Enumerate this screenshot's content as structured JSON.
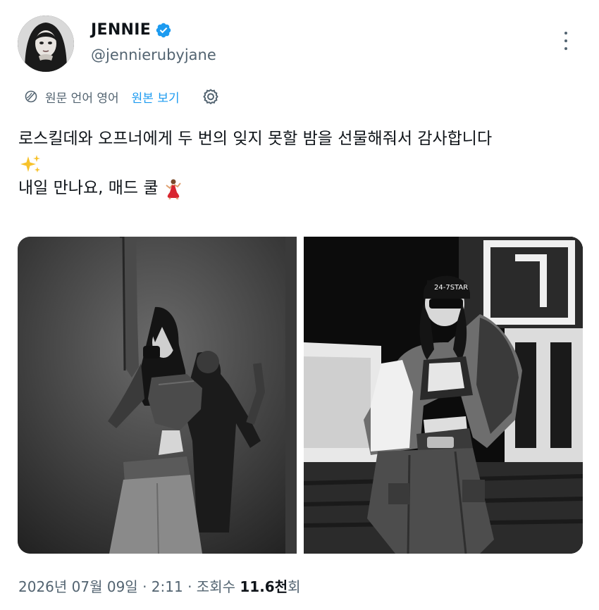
{
  "tweet": {
    "display_name": "JENNIE",
    "handle": "@jennierubyjane",
    "verified_icon": "verified-badge-icon",
    "more_icon": "more-horizontal-icon",
    "translate": {
      "label": "원문 언어 영어",
      "view_original": "원본 보기",
      "globe_icon": "globe-translate-icon",
      "settings_icon": "gear-icon"
    },
    "text_line_1": "로스킬데와 오프너에게 두 번의 잊지 못할 밤을 선물해줘서 감사합니다",
    "text_line_2_emoji": "sparkles-emoji",
    "text_line_3": "내일 만나요, 매드 쿨",
    "text_line_3_emoji": "dancer-emoji",
    "media": [
      {
        "alt": "photo-1"
      },
      {
        "alt": "photo-2"
      }
    ],
    "date": "2026년 07월 09일",
    "separator_1": "·",
    "time": "2:11",
    "separator_2": "·",
    "views_label": "조회수",
    "views_count": "11.6천",
    "views_suffix": "회"
  },
  "colors": {
    "text": "#0f1419",
    "secondary": "#536471",
    "link": "#1d9bf0",
    "verified": "#1d9bf0"
  }
}
